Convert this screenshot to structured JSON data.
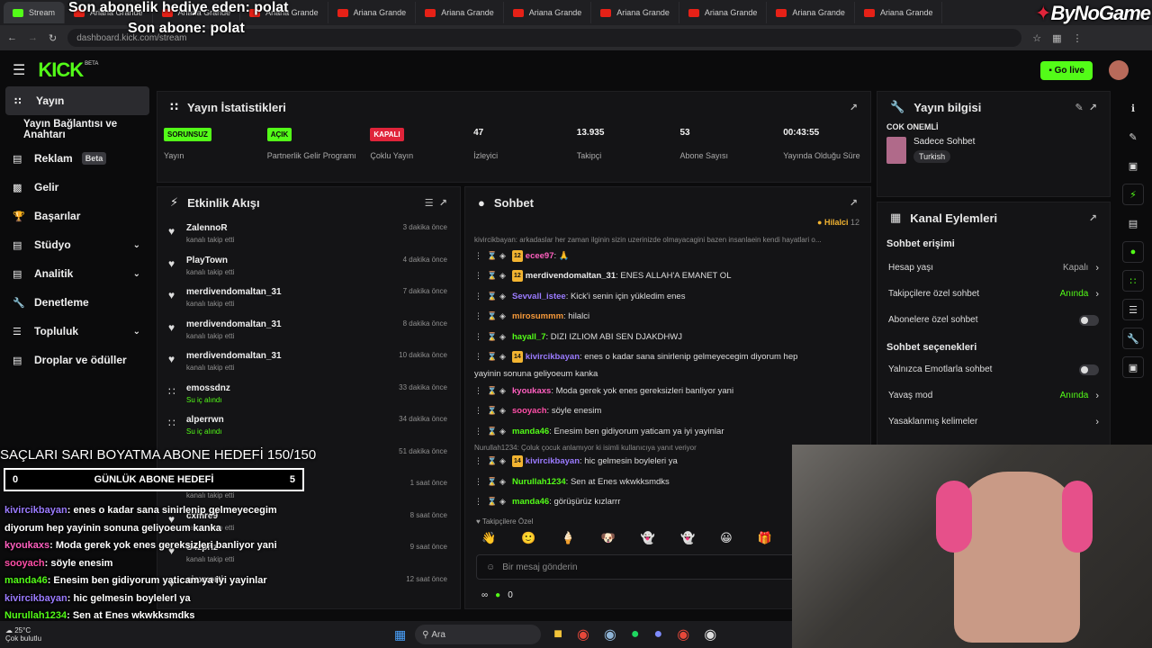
{
  "browser": {
    "tabs": [
      {
        "label": "Stream",
        "active": true
      },
      {
        "label": "Ariana Grande"
      },
      {
        "label": "Ariana Grande"
      },
      {
        "label": "Ariana Grande"
      },
      {
        "label": "Ariana Grande"
      },
      {
        "label": "Ariana Grande"
      },
      {
        "label": "Ariana Grande"
      },
      {
        "label": "Ariana Grande"
      },
      {
        "label": "Ariana Grande"
      },
      {
        "label": "Ariana Grande"
      },
      {
        "label": "Ariana Grande"
      }
    ],
    "url": "dashboard.kick.com/stream"
  },
  "overlay": {
    "gift_line": "Son abonelik hediye eden: polat",
    "sub_line": "Son abone: polat",
    "watermark": "ByNoGame",
    "goal_title": "SAÇLARI SARI BOYATMA ABONE HEDEFİ 150/150",
    "daily_label": "GÜNLÜK ABONE HEDEFİ",
    "daily_min": "0",
    "daily_max": "5",
    "chat": [
      {
        "user": "kivircikbayan",
        "text": ": enes o kadar sana sinirlenip gelmeyecegim",
        "color": "#9b7bff"
      },
      {
        "user": "",
        "text": "diyorum hep yayinin sonuna geliyoeum kanka",
        "color": "#9b7bff"
      },
      {
        "user": "kyoukaxs",
        "text": ": Moda gerek yok enes gereksizleri banliyor yani",
        "color": "#ff5fbf"
      },
      {
        "user": "sooyach",
        "text": ": söyle enesim",
        "color": "#ff4fa8"
      },
      {
        "user": "manda46",
        "text": ": Enesim ben gidiyorum yaticam ya iyi yayinlar",
        "color": "#53fc18"
      },
      {
        "user": "kivircikbayan",
        "text": ": hic gelmesin boylelerl ya",
        "color": "#9b7bff"
      },
      {
        "user": "Nurullah1234",
        "text": ": Sen at Enes wkwkksmdks",
        "color": "#53fc18"
      }
    ],
    "weather_temp": "25°C",
    "weather_desc": "Çok bulutlu"
  },
  "app": {
    "logo": "KICK",
    "logo_beta": "BETA",
    "go_live": "Go live"
  },
  "sidebar": {
    "items": [
      {
        "label": "Yayın",
        "icon": "broadcast-icon"
      },
      {
        "label": "Yayın Bağlantısı ve Anahtarı",
        "icon": ""
      },
      {
        "label": "Reklam",
        "icon": "ad-icon",
        "badge": "Beta"
      },
      {
        "label": "Gelir",
        "icon": "chart-icon"
      },
      {
        "label": "Başarılar",
        "icon": "trophy-icon"
      },
      {
        "label": "Stüdyo",
        "icon": "studio-icon"
      },
      {
        "label": "Analitik",
        "icon": "analytics-icon"
      },
      {
        "label": "Denetleme",
        "icon": "wrench-icon"
      },
      {
        "label": "Topluluk",
        "icon": "community-icon"
      },
      {
        "label": "Droplar ve ödüller",
        "icon": "drops-icon"
      }
    ]
  },
  "stats": {
    "title": "Yayın İstatistikleri",
    "items": [
      {
        "value": "SORUNSUZ",
        "label": "Yayın",
        "tag": "#53fc18"
      },
      {
        "value": "AÇIK",
        "label": "Partnerlik Gelir Programı",
        "tag": "#53fc18"
      },
      {
        "value": "KAPALI",
        "label": "Çoklu Yayın",
        "tag": "#e0243a"
      },
      {
        "value": "47",
        "label": "İzleyici"
      },
      {
        "value": "13.935",
        "label": "Takipçi"
      },
      {
        "value": "53",
        "label": "Abone Sayısı"
      },
      {
        "value": "00:43:55",
        "label": "Yayında Olduğu Süre"
      }
    ]
  },
  "activity": {
    "title": "Etkinlik Akışı",
    "items": [
      {
        "name": "ZalennoR",
        "sub": "kanalı takip etti",
        "time": "3 dakika önce"
      },
      {
        "name": "PlayTown",
        "sub": "kanalı takip etti",
        "time": "4 dakika önce"
      },
      {
        "name": "merdivendomaltan_31",
        "sub": "kanalı takip etti",
        "time": "7 dakika önce"
      },
      {
        "name": "merdivendomaltan_31",
        "sub": "kanalı takip etti",
        "time": "8 dakika önce"
      },
      {
        "name": "merdivendomaltan_31",
        "sub": "kanalı takip etti",
        "time": "10 dakika önce"
      },
      {
        "name": "emossdnz",
        "sub": "Su iç alındı",
        "time": "33 dakika önce",
        "reward": true
      },
      {
        "name": "alperrwn",
        "sub": "Su iç alındı",
        "time": "34 dakika önce",
        "reward": true
      },
      {
        "name": "",
        "sub": "",
        "time": "51 dakika önce",
        "reward": true
      },
      {
        "name": "Ky7a",
        "sub": "kanalı takip etti",
        "time": "1 saat önce"
      },
      {
        "name": "cxmre9",
        "sub": "kanalı takip etti",
        "time": "8 saat önce"
      },
      {
        "name": "S4zpriz",
        "sub": "kanalı takip etti",
        "time": "9 saat önce"
      },
      {
        "name": "aisxxorti",
        "sub": "",
        "time": "12 saat önce"
      }
    ]
  },
  "chat": {
    "title": "Sohbet",
    "top_user": "Hilalci",
    "top_count": "12",
    "reply_hint_1": "kivircikbayan: arkadaslar her zaman ilginin sizin uzerinizde olmayacagini bazen insanlaein kendi hayatlari o...",
    "reply_hint_2": "Nurullah1234: Çoluk çocuk anlamıyor ki isimli kullanıcıya yanıt veriyor",
    "messages": [
      {
        "lvl": "12",
        "user": "ecee97",
        "text": ": 🙏",
        "color": "#ff5fbf"
      },
      {
        "lvl": "12",
        "user": "merdivendomaltan_31",
        "text": ": ENES ALLAH'A EMANET OL",
        "color": "#e9e9e9"
      },
      {
        "lvl": "",
        "user": "Sevvall_istee",
        "text": ": Kick'i senin için yükledim enes",
        "color": "#9b7bff"
      },
      {
        "lvl": "",
        "user": "mirosummm",
        "text": ": hilalci",
        "color": "#f79a3a"
      },
      {
        "lvl": "",
        "user": "hayall_7",
        "text": ": DIZI IZLIOM ABI SEN DJAKDHWJ",
        "color": "#53fc18"
      },
      {
        "lvl": "14",
        "user": "kivircikbayan",
        "text": ": enes o kadar sana sinirlenip gelmeyecegim diyorum hep",
        "color": "#9b7bff"
      },
      {
        "lvl": "",
        "user": "",
        "text": "yayinin sonuna geliyoeum kanka",
        "color": "#e9e9e9"
      },
      {
        "lvl": "",
        "user": "kyoukaxs",
        "text": ": Moda gerek yok enes gereksizleri banliyor yani",
        "color": "#ff5fbf"
      },
      {
        "lvl": "",
        "user": "sooyach",
        "text": ": söyle enesim",
        "color": "#ff4fa8"
      },
      {
        "lvl": "",
        "user": "manda46",
        "text": ": Enesim ben gidiyorum yaticam ya iyi yayinlar",
        "color": "#53fc18"
      },
      {
        "lvl": "14",
        "user": "kivircikbayan",
        "text": ": hic gelmesin boyleleri ya",
        "color": "#9b7bff"
      },
      {
        "lvl": "",
        "user": "Nurullah1234",
        "text": ": Sen at Enes wkwkksmdks",
        "color": "#53fc18"
      },
      {
        "lvl": "",
        "user": "manda46",
        "text": ": görüşürüz kızlarrr",
        "color": "#53fc18"
      }
    ],
    "followers_only": "Takipçilere Özel",
    "input_placeholder": "Bir mesaj gönderin",
    "points": "0"
  },
  "info": {
    "title": "Yayın bilgisi",
    "heading": "COK ONEMLİ",
    "category": "Sadece Sohbet",
    "language": "Turkish"
  },
  "channel": {
    "title": "Kanal Eylemleri",
    "section1": "Sohbet erişimi",
    "rows1": [
      {
        "label": "Hesap yaşı",
        "value": "Kapalı",
        "kind": "link"
      },
      {
        "label": "Takipçilere özel sohbet",
        "value": "Anında",
        "kind": "green"
      },
      {
        "label": "Abonelere özel sohbet",
        "value": "",
        "kind": "toggle"
      }
    ],
    "section2": "Sohbet seçenekleri",
    "rows2": [
      {
        "label": "Yalnızca Emotlarla sohbet",
        "value": "",
        "kind": "toggle"
      },
      {
        "label": "Yavaş mod",
        "value": "Anında",
        "kind": "green"
      },
      {
        "label": "Yasaklanmış kelimeler",
        "value": "",
        "kind": "link"
      }
    ]
  },
  "taskbar": {
    "search": "Ara"
  },
  "colors": {
    "accent": "#53fc18",
    "danger": "#e0243a",
    "bg": "#0b0b0c",
    "panel": "#141416"
  }
}
